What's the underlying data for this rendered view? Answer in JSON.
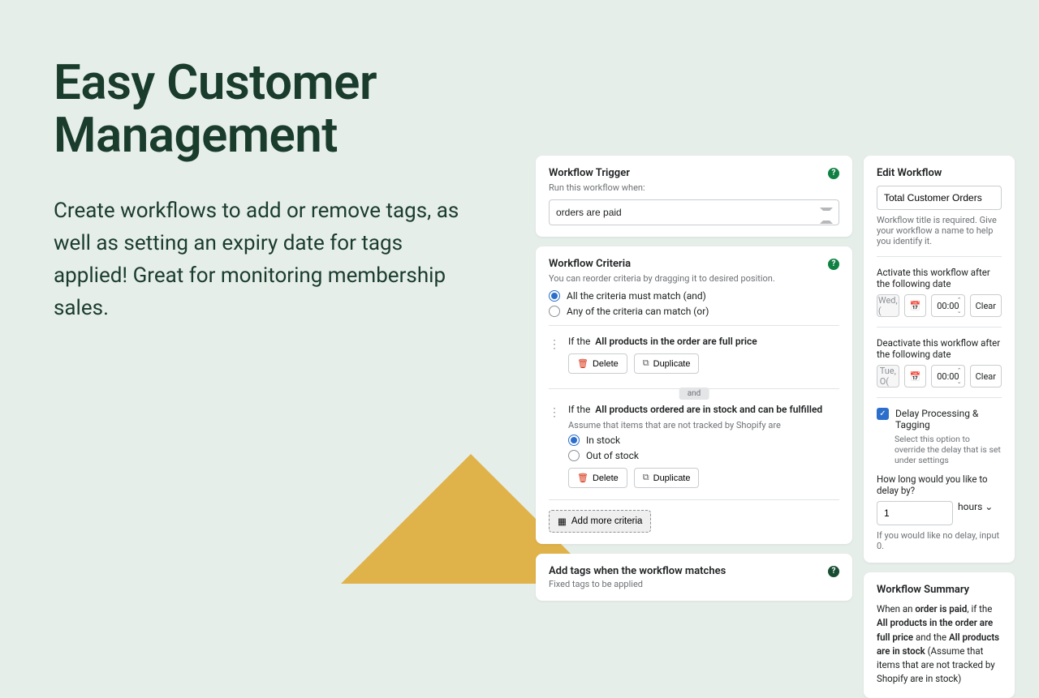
{
  "hero": {
    "title_l1": "Easy Customer",
    "title_l2": "Management",
    "body": "Create workflows to add or remove tags, as well as setting an expiry date for tags applied! Great for monitoring membership sales."
  },
  "trigger": {
    "title": "Workflow Trigger",
    "subtitle": "Run this workflow when:",
    "selected": "orders are paid"
  },
  "criteria": {
    "title": "Workflow Criteria",
    "subtitle": "You can reorder criteria by dragging it to desired position.",
    "radio_all": "All the criteria must match (and)",
    "radio_any": "Any of the criteria can match (or)",
    "if_prefix": "If the",
    "item1_cond": "All products in the order are full price",
    "item2_cond": "All products ordered are in stock and can be fulfilled",
    "item2_sub": "Assume that items that are not tracked by Shopify are",
    "opt_in_stock": "In stock",
    "opt_out_stock": "Out of stock",
    "delete": "Delete",
    "duplicate": "Duplicate",
    "and": "and",
    "add_more": "Add more criteria"
  },
  "tags_card": {
    "title": "Add tags when the workflow matches",
    "sub": "Fixed tags to be applied"
  },
  "edit": {
    "title": "Edit Workflow",
    "name_value": "Total Customer Orders",
    "name_help": "Workflow title is required. Give your workflow a name to help you identify it.",
    "activate_label": "Activate this workflow after the following date",
    "deactivate_label": "Deactivate this workflow after the following date",
    "date1_placeholder": "Wed, (",
    "date2_placeholder": "Tue, O(",
    "time": "00:00",
    "clear": "Clear",
    "delay_check": "Delay Processing & Tagging",
    "delay_sub": "Select this option to override the delay that is set under settings",
    "delay_q": "How long would you like to delay by?",
    "delay_val": "1",
    "delay_unit": "hours",
    "delay_hint": "If you would like no delay, input 0."
  },
  "summary": {
    "title": "Workflow Summary",
    "t1": "When an ",
    "b1": "order is paid",
    "t2": ", if the ",
    "b2": "All products in the order are full price",
    "t3": " and the ",
    "b3": "All products are in stock",
    "t4": " (Assume that items that are not tracked by Shopify are in stock)"
  }
}
